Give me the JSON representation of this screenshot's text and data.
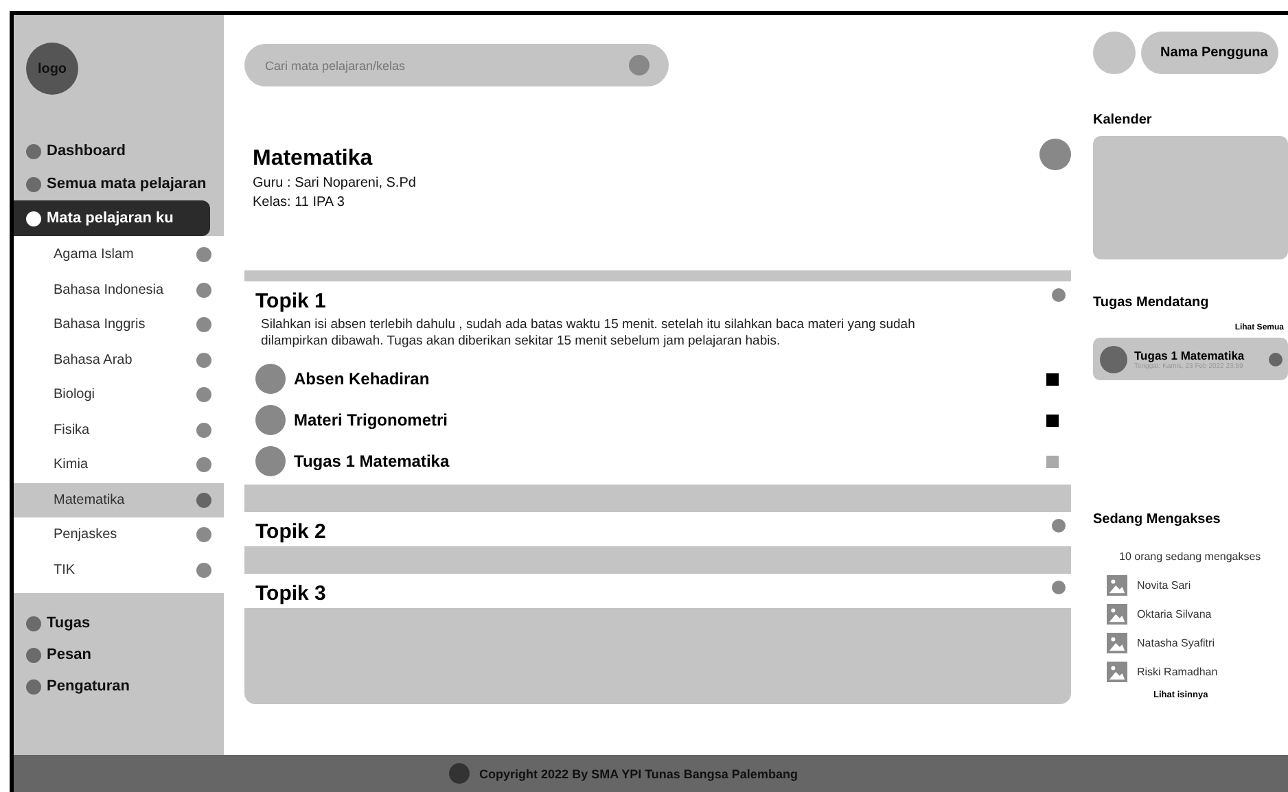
{
  "sidebar": {
    "logo": "logo",
    "nav_top": [
      {
        "label": "Dashboard",
        "selected": false
      },
      {
        "label": "Semua mata pelajaran",
        "selected": false
      },
      {
        "label": "Mata pelajaran ku",
        "selected": true
      }
    ],
    "subjects": [
      {
        "label": "Agama Islam",
        "selected": false
      },
      {
        "label": "Bahasa Indonesia",
        "selected": false
      },
      {
        "label": "Bahasa Inggris",
        "selected": false
      },
      {
        "label": "Bahasa Arab",
        "selected": false
      },
      {
        "label": "Biologi",
        "selected": false
      },
      {
        "label": "Fisika",
        "selected": false
      },
      {
        "label": "Kimia",
        "selected": false
      },
      {
        "label": "Matematika",
        "selected": true
      },
      {
        "label": "Penjaskes",
        "selected": false
      },
      {
        "label": "TIK",
        "selected": false
      }
    ],
    "nav_bottom": [
      {
        "label": "Tugas",
        "selected": false
      },
      {
        "label": "Pesan",
        "selected": false
      },
      {
        "label": "Pengaturan",
        "selected": false
      }
    ]
  },
  "search": {
    "placeholder": "Cari mata pelajaran/kelas"
  },
  "course": {
    "title": "Matematika",
    "teacher": "Guru : Sari Nopareni, S.Pd",
    "class": "Kelas: 11 IPA 3"
  },
  "topics": [
    {
      "title": "Topik 1",
      "description": "Silahkan isi absen terlebih dahulu , sudah ada batas waktu 15 menit. setelah itu silahkan baca materi yang sudah dilampirkan dibawah. Tugas akan diberikan sekitar 15 menit sebelum jam pelajaran habis.",
      "items": [
        {
          "label": "Absen Kehadiran",
          "done": true
        },
        {
          "label": "Materi Trigonometri",
          "done": true
        },
        {
          "label": "Tugas 1 Matematika",
          "done": false
        }
      ]
    },
    {
      "title": "Topik 2"
    },
    {
      "title": "Topik 3"
    }
  ],
  "user": {
    "name": "Nama Pengguna"
  },
  "calendar": {
    "title": "Kalender"
  },
  "upcoming": {
    "title": "Tugas Mendatang",
    "see_all": "Lihat Semua",
    "tasks": [
      {
        "title": "Tugas 1 Matematika",
        "due": "Tenggat: Kamis, 23 Feb 2022 23:59"
      }
    ]
  },
  "accessing": {
    "title": "Sedang Mengakses",
    "count": "10 orang sedang mengakses",
    "users": [
      "Novita Sari",
      "Oktaria Silvana",
      "Natasha Syafitri",
      "Riski Ramadhan"
    ],
    "more": "Lihat isinnya"
  },
  "footer": {
    "text": "Copyright 2022 By SMA YPI Tunas Bangsa Palembang"
  }
}
